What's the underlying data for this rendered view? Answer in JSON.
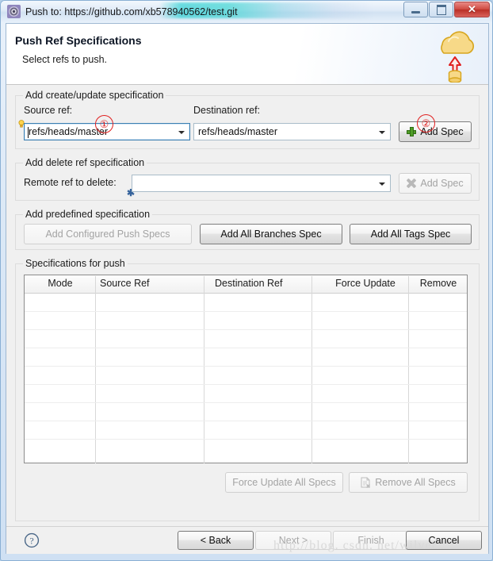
{
  "window": {
    "title": "Push to: https://github.com/xb578940562/test.git",
    "icon": "git-repository-icon",
    "controls": {
      "minimize": "minimize-button",
      "maximize": "maximize-button",
      "close": "close-button",
      "close_glyph": "✕"
    }
  },
  "header": {
    "title": "Push Ref Specifications",
    "subtitle": "Select refs to push.",
    "graphic": "cloud-push-icon"
  },
  "groups": {
    "create_update": {
      "title": "Add create/update specification",
      "source_label": "Source ref:",
      "source_value": "refs/heads/master",
      "destination_label": "Destination ref:",
      "destination_value": "refs/heads/master",
      "add_spec_label": "Add Spec"
    },
    "delete_ref": {
      "title": "Add delete ref specification",
      "remote_label": "Remote ref to delete:",
      "remote_value": "",
      "add_spec_label": "Add Spec"
    },
    "predefined": {
      "title": "Add predefined specification",
      "configured_label": "Add Configured Push Specs",
      "all_branches_label": "Add All Branches Spec",
      "all_tags_label": "Add All Tags Spec"
    },
    "specifications": {
      "title": "Specifications for push",
      "force_update_all_label": "Force Update All Specs",
      "remove_all_label": "Remove All Specs"
    }
  },
  "table": {
    "columns": [
      "Mode",
      "Source Ref",
      "Destination Ref",
      "Force Update",
      "Remove"
    ],
    "rows": []
  },
  "footer": {
    "help": "?",
    "back_label": "< Back",
    "next_label": "Next >",
    "finish_label": "Finish",
    "cancel_label": "Cancel"
  },
  "annotations": [
    {
      "label": "①",
      "target": "source-ref-combo"
    },
    {
      "label": "②",
      "target": "add-spec-create-button"
    }
  ],
  "watermark": "http://blog. csdn. net/wilver",
  "colors": {
    "accent_red": "#e02020",
    "close_red": "#cf4b42",
    "cloud_yellow": "#f5d36b",
    "plus_green": "#4f9e27",
    "focus_blue": "#3c7fb1"
  }
}
